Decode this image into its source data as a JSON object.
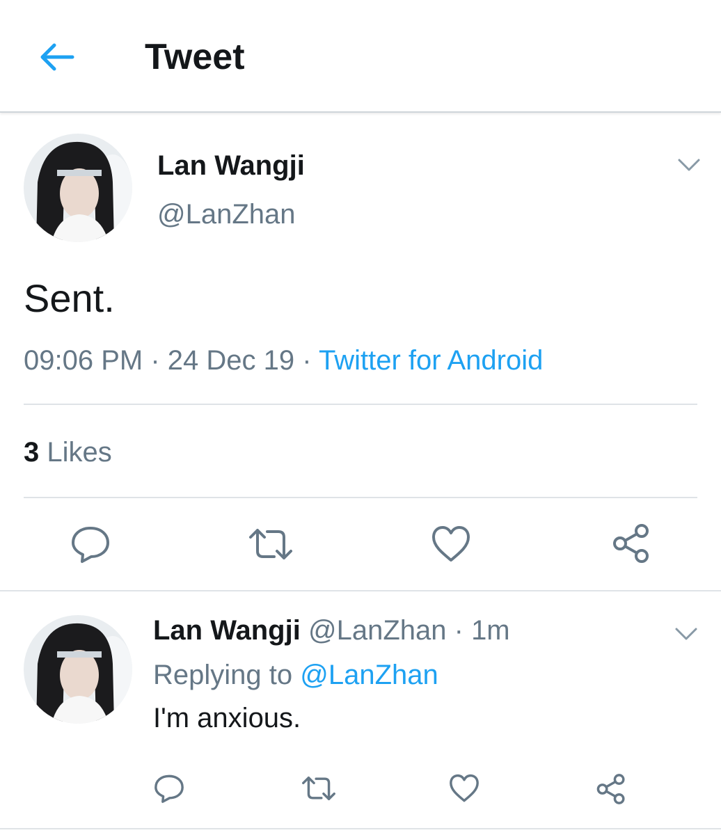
{
  "header": {
    "title": "Tweet"
  },
  "tweet": {
    "name": "Lan Wangji",
    "handle": "@LanZhan",
    "text": "Sent.",
    "time": "09:06 PM",
    "date": "24 Dec 19",
    "source": "Twitter for Android",
    "likes_count": "3",
    "likes_label": "Likes"
  },
  "reply": {
    "name": "Lan Wangji",
    "handle": "@LanZhan",
    "age": "1m",
    "replying_prefix": "Replying to",
    "replying_to": "@LanZhan",
    "text": "I'm anxious."
  },
  "separator": "·",
  "colors": {
    "accent": "#1da1f2",
    "muted": "#657786",
    "text": "#14171a",
    "divider": "#dfe3e7"
  },
  "icons": [
    "back-arrow-icon",
    "chevron-down-icon",
    "reply-icon",
    "retweet-icon",
    "like-icon",
    "share-icon"
  ]
}
